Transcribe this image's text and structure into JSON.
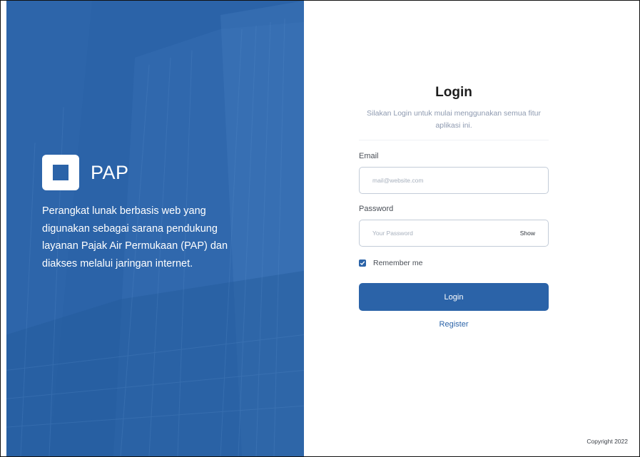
{
  "branding": {
    "name": "PAP",
    "tagline": "Perangkat lunak berbasis web yang digunakan sebagai sarana pendukung layanan Pajak Air Permukaan (PAP) dan diakses melalui jaringan internet.",
    "logo_icon": "square-logo-icon"
  },
  "login": {
    "title": "Login",
    "subtitle": "Silakan Login untuk mulai menggunakan semua fitur aplikasi ini.",
    "email_label": "Email",
    "email_placeholder": "mail@website.com",
    "password_label": "Password",
    "password_placeholder": "Your Password",
    "show_label": "Show",
    "remember_label": "Remember me",
    "remember_checked": true,
    "login_button": "Login",
    "register_link": "Register"
  },
  "footer": {
    "copyright": "Copyright 2022"
  },
  "colors": {
    "primary": "#2b63a8",
    "subtitle": "#8e9ab0",
    "border": "#c3ccd8"
  }
}
